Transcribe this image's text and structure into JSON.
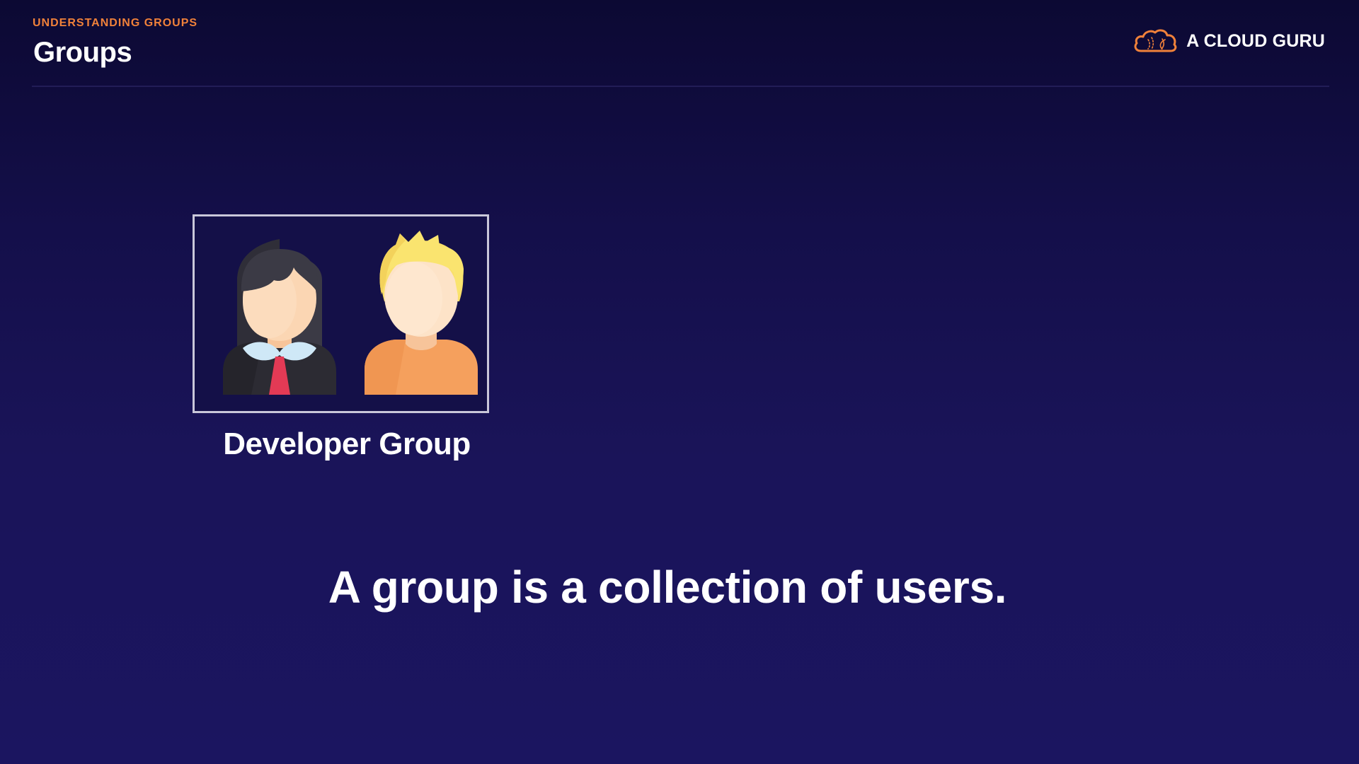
{
  "header": {
    "kicker": "UNDERSTANDING GROUPS",
    "title": "Groups"
  },
  "brand": {
    "name": "A CLOUD GURU",
    "icon": "cloud-logo-icon",
    "accent_color": "#f0813a"
  },
  "group": {
    "label": "Developer Group",
    "members": [
      {
        "icon": "female-user-avatar-icon"
      },
      {
        "icon": "male-user-avatar-icon"
      }
    ],
    "border_color": "#c9c7d9"
  },
  "caption": "A group is a collection of users.",
  "colors": {
    "background": "#140f4a",
    "text": "#ffffff"
  }
}
